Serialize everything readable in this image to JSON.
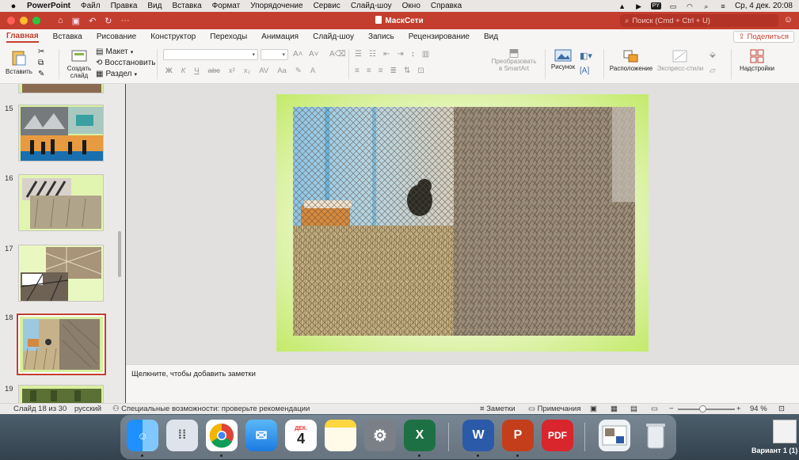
{
  "menubar": {
    "app": "PowerPoint",
    "items": [
      "Файл",
      "Правка",
      "Вид",
      "Вставка",
      "Формат",
      "Упорядочение",
      "Сервис",
      "Слайд-шоу",
      "Окно",
      "Справка"
    ],
    "badge": "PY",
    "clock": "Ср, 4 дек.  20:08"
  },
  "titlebar": {
    "title": "МаскСети",
    "search_placeholder": "Поиск (Cmd + Ctrl + U)"
  },
  "ribbon_tabs": {
    "items": [
      "Главная",
      "Вставка",
      "Рисование",
      "Конструктор",
      "Переходы",
      "Анимация",
      "Слайд-шоу",
      "Запись",
      "Рецензирование",
      "Вид"
    ],
    "active": "Главная",
    "share_label": "Поделиться"
  },
  "ribbon": {
    "paste": "Вставить",
    "create_slide": "Создать слайд",
    "layout": "Макет",
    "reset": "Восстановить",
    "section": "Раздел",
    "smartart": "Преобразовать в SmartArt",
    "picture": "Рисунок",
    "arrange": "Расположение",
    "quick_styles": "Экспресс-стили",
    "addins": "Надстройки",
    "font_buttons": [
      "Ж",
      "К",
      "Ч",
      "abc",
      "x²",
      "x₂",
      "AV",
      "Aa"
    ]
  },
  "slides": [
    {
      "number": "15"
    },
    {
      "number": "16"
    },
    {
      "number": "17"
    },
    {
      "number": "18",
      "selected": true
    },
    {
      "number": "19"
    }
  ],
  "notes": {
    "placeholder": "Щелкните, чтобы добавить заметки"
  },
  "status": {
    "slide_info": "Слайд 18 из 30",
    "language": "русский",
    "accessibility": "Специальные возможности: проверьте рекомендации",
    "notes_btn": "Заметки",
    "comments_btn": "Примечания",
    "zoom": "94 %",
    "zoom_minus": "−",
    "zoom_plus": "+"
  },
  "dock": {
    "calendar_month": "ДЕК.",
    "calendar_day": "4",
    "desktop_file_label": "Вариант 1 (1)",
    "apps": [
      "finder-icon",
      "launchpad-icon",
      "chrome-icon",
      "mail-icon",
      "calendar-icon",
      "notes-icon",
      "system-settings-icon",
      "excel-icon",
      "word-icon",
      "powerpoint-icon",
      "pdf-icon",
      "preview-icon",
      "trash-icon"
    ]
  },
  "colors": {
    "accent": "#c43e2f",
    "slide_border_green": "#c3ea6a"
  }
}
